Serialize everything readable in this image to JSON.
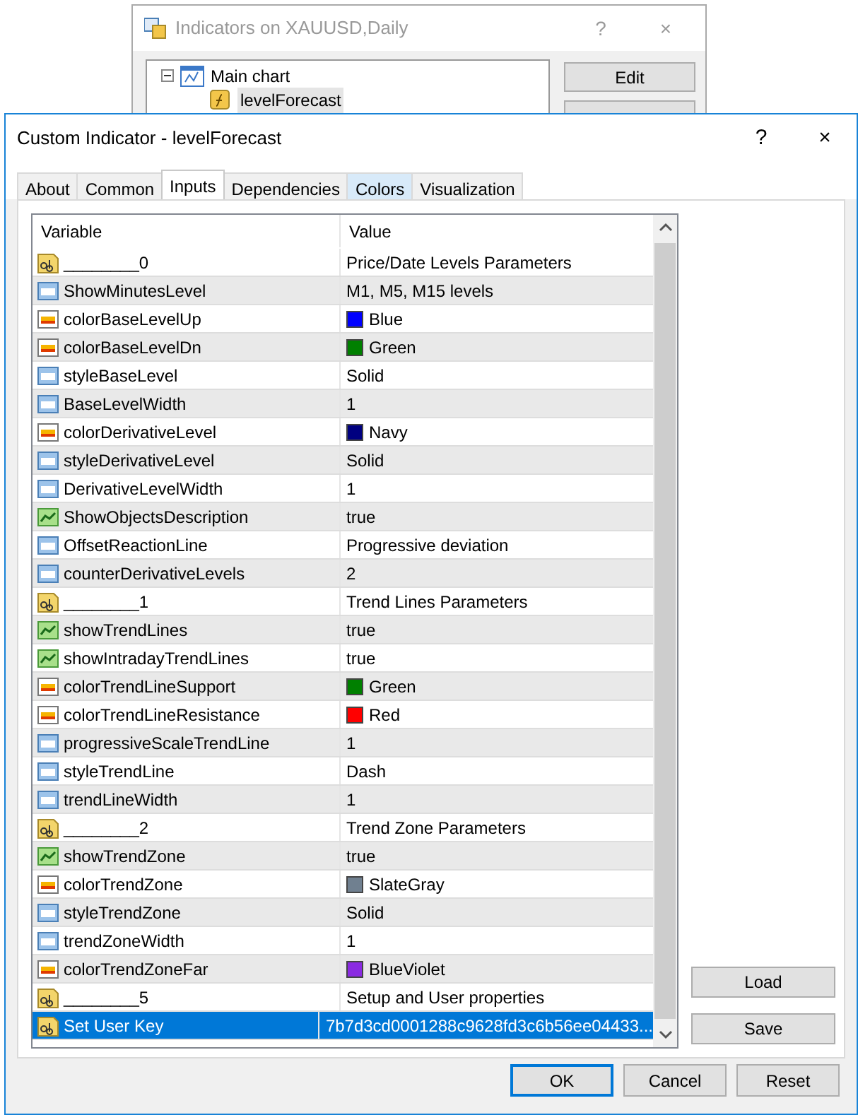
{
  "background_window": {
    "title": "Indicators on XAUUSD,Daily",
    "help": "?",
    "close": "×",
    "tree": [
      {
        "label": "Main chart",
        "expanded": true,
        "children": [
          {
            "label": "levelForecast",
            "selected": true
          }
        ]
      }
    ],
    "buttons": [
      "Edit"
    ]
  },
  "dialog": {
    "title": "Custom Indicator - levelForecast",
    "help": "?",
    "close": "×",
    "tabs": [
      {
        "label": "About",
        "selected": false,
        "hovered": false
      },
      {
        "label": "Common",
        "selected": false,
        "hovered": false
      },
      {
        "label": "Inputs",
        "selected": true,
        "hovered": false
      },
      {
        "label": "Dependencies",
        "selected": false,
        "hovered": false
      },
      {
        "label": "Colors",
        "selected": false,
        "hovered": true
      },
      {
        "label": "Visualization",
        "selected": false,
        "hovered": false
      }
    ],
    "table": {
      "columns": [
        "Variable",
        "Value"
      ],
      "rows": [
        {
          "kind": "string",
          "name": "________0",
          "value": "Price/Date Levels Parameters",
          "selected": false
        },
        {
          "kind": "int",
          "name": "ShowMinutesLevel",
          "value": "M1, M5, M15  levels",
          "selected": false
        },
        {
          "kind": "color",
          "name": "colorBaseLevelUp",
          "value": "Blue",
          "color": "#0000ff",
          "selected": false
        },
        {
          "kind": "color",
          "name": "colorBaseLevelDn",
          "value": "Green",
          "color": "#008000",
          "selected": false
        },
        {
          "kind": "int",
          "name": "styleBaseLevel",
          "value": "Solid",
          "selected": false
        },
        {
          "kind": "int",
          "name": "BaseLevelWidth",
          "value": "1",
          "selected": false
        },
        {
          "kind": "color",
          "name": "colorDerivativeLevel",
          "value": "Navy",
          "color": "#000080",
          "selected": false
        },
        {
          "kind": "int",
          "name": "styleDerivativeLevel",
          "value": "Solid",
          "selected": false
        },
        {
          "kind": "int",
          "name": "DerivativeLevelWidth",
          "value": "1",
          "selected": false
        },
        {
          "kind": "bool",
          "name": "ShowObjectsDescription",
          "value": "true",
          "selected": false
        },
        {
          "kind": "int",
          "name": "OffsetReactionLine",
          "value": "Progressive deviation",
          "selected": false
        },
        {
          "kind": "int",
          "name": "counterDerivativeLevels",
          "value": "2",
          "selected": false
        },
        {
          "kind": "string",
          "name": "________1",
          "value": "Trend Lines Parameters",
          "selected": false
        },
        {
          "kind": "bool",
          "name": "showTrendLines",
          "value": "true",
          "selected": false
        },
        {
          "kind": "bool",
          "name": "showIntradayTrendLines",
          "value": "true",
          "selected": false
        },
        {
          "kind": "color",
          "name": "colorTrendLineSupport",
          "value": "Green",
          "color": "#008000",
          "selected": false
        },
        {
          "kind": "color",
          "name": "colorTrendLineResistance",
          "value": "Red",
          "color": "#ff0000",
          "selected": false
        },
        {
          "kind": "int",
          "name": "progressiveScaleTrendLine",
          "value": "1",
          "selected": false
        },
        {
          "kind": "int",
          "name": "styleTrendLine",
          "value": "Dash",
          "selected": false
        },
        {
          "kind": "int",
          "name": "trendLineWidth",
          "value": "1",
          "selected": false
        },
        {
          "kind": "string",
          "name": "________2",
          "value": "Trend Zone Parameters",
          "selected": false
        },
        {
          "kind": "bool",
          "name": "showTrendZone",
          "value": "true",
          "selected": false
        },
        {
          "kind": "color",
          "name": "colorTrendZone",
          "value": "SlateGray",
          "color": "#708090",
          "selected": false
        },
        {
          "kind": "int",
          "name": "styleTrendZone",
          "value": "Solid",
          "selected": false
        },
        {
          "kind": "int",
          "name": "trendZoneWidth",
          "value": "1",
          "selected": false
        },
        {
          "kind": "color",
          "name": "colorTrendZoneFar",
          "value": "BlueViolet",
          "color": "#8a2be2",
          "selected": false
        },
        {
          "kind": "string",
          "name": "________5",
          "value": "Setup and User properties",
          "selected": false
        },
        {
          "kind": "string",
          "name": "Set User Key",
          "value": "7b7d3cd0001288c9628fd3c6b56ee04433...",
          "selected": true
        }
      ]
    },
    "side_buttons": [
      "Load",
      "Save"
    ],
    "buttons": [
      {
        "label": "OK",
        "default": true
      },
      {
        "label": "Cancel",
        "default": false
      },
      {
        "label": "Reset",
        "default": false
      }
    ]
  }
}
